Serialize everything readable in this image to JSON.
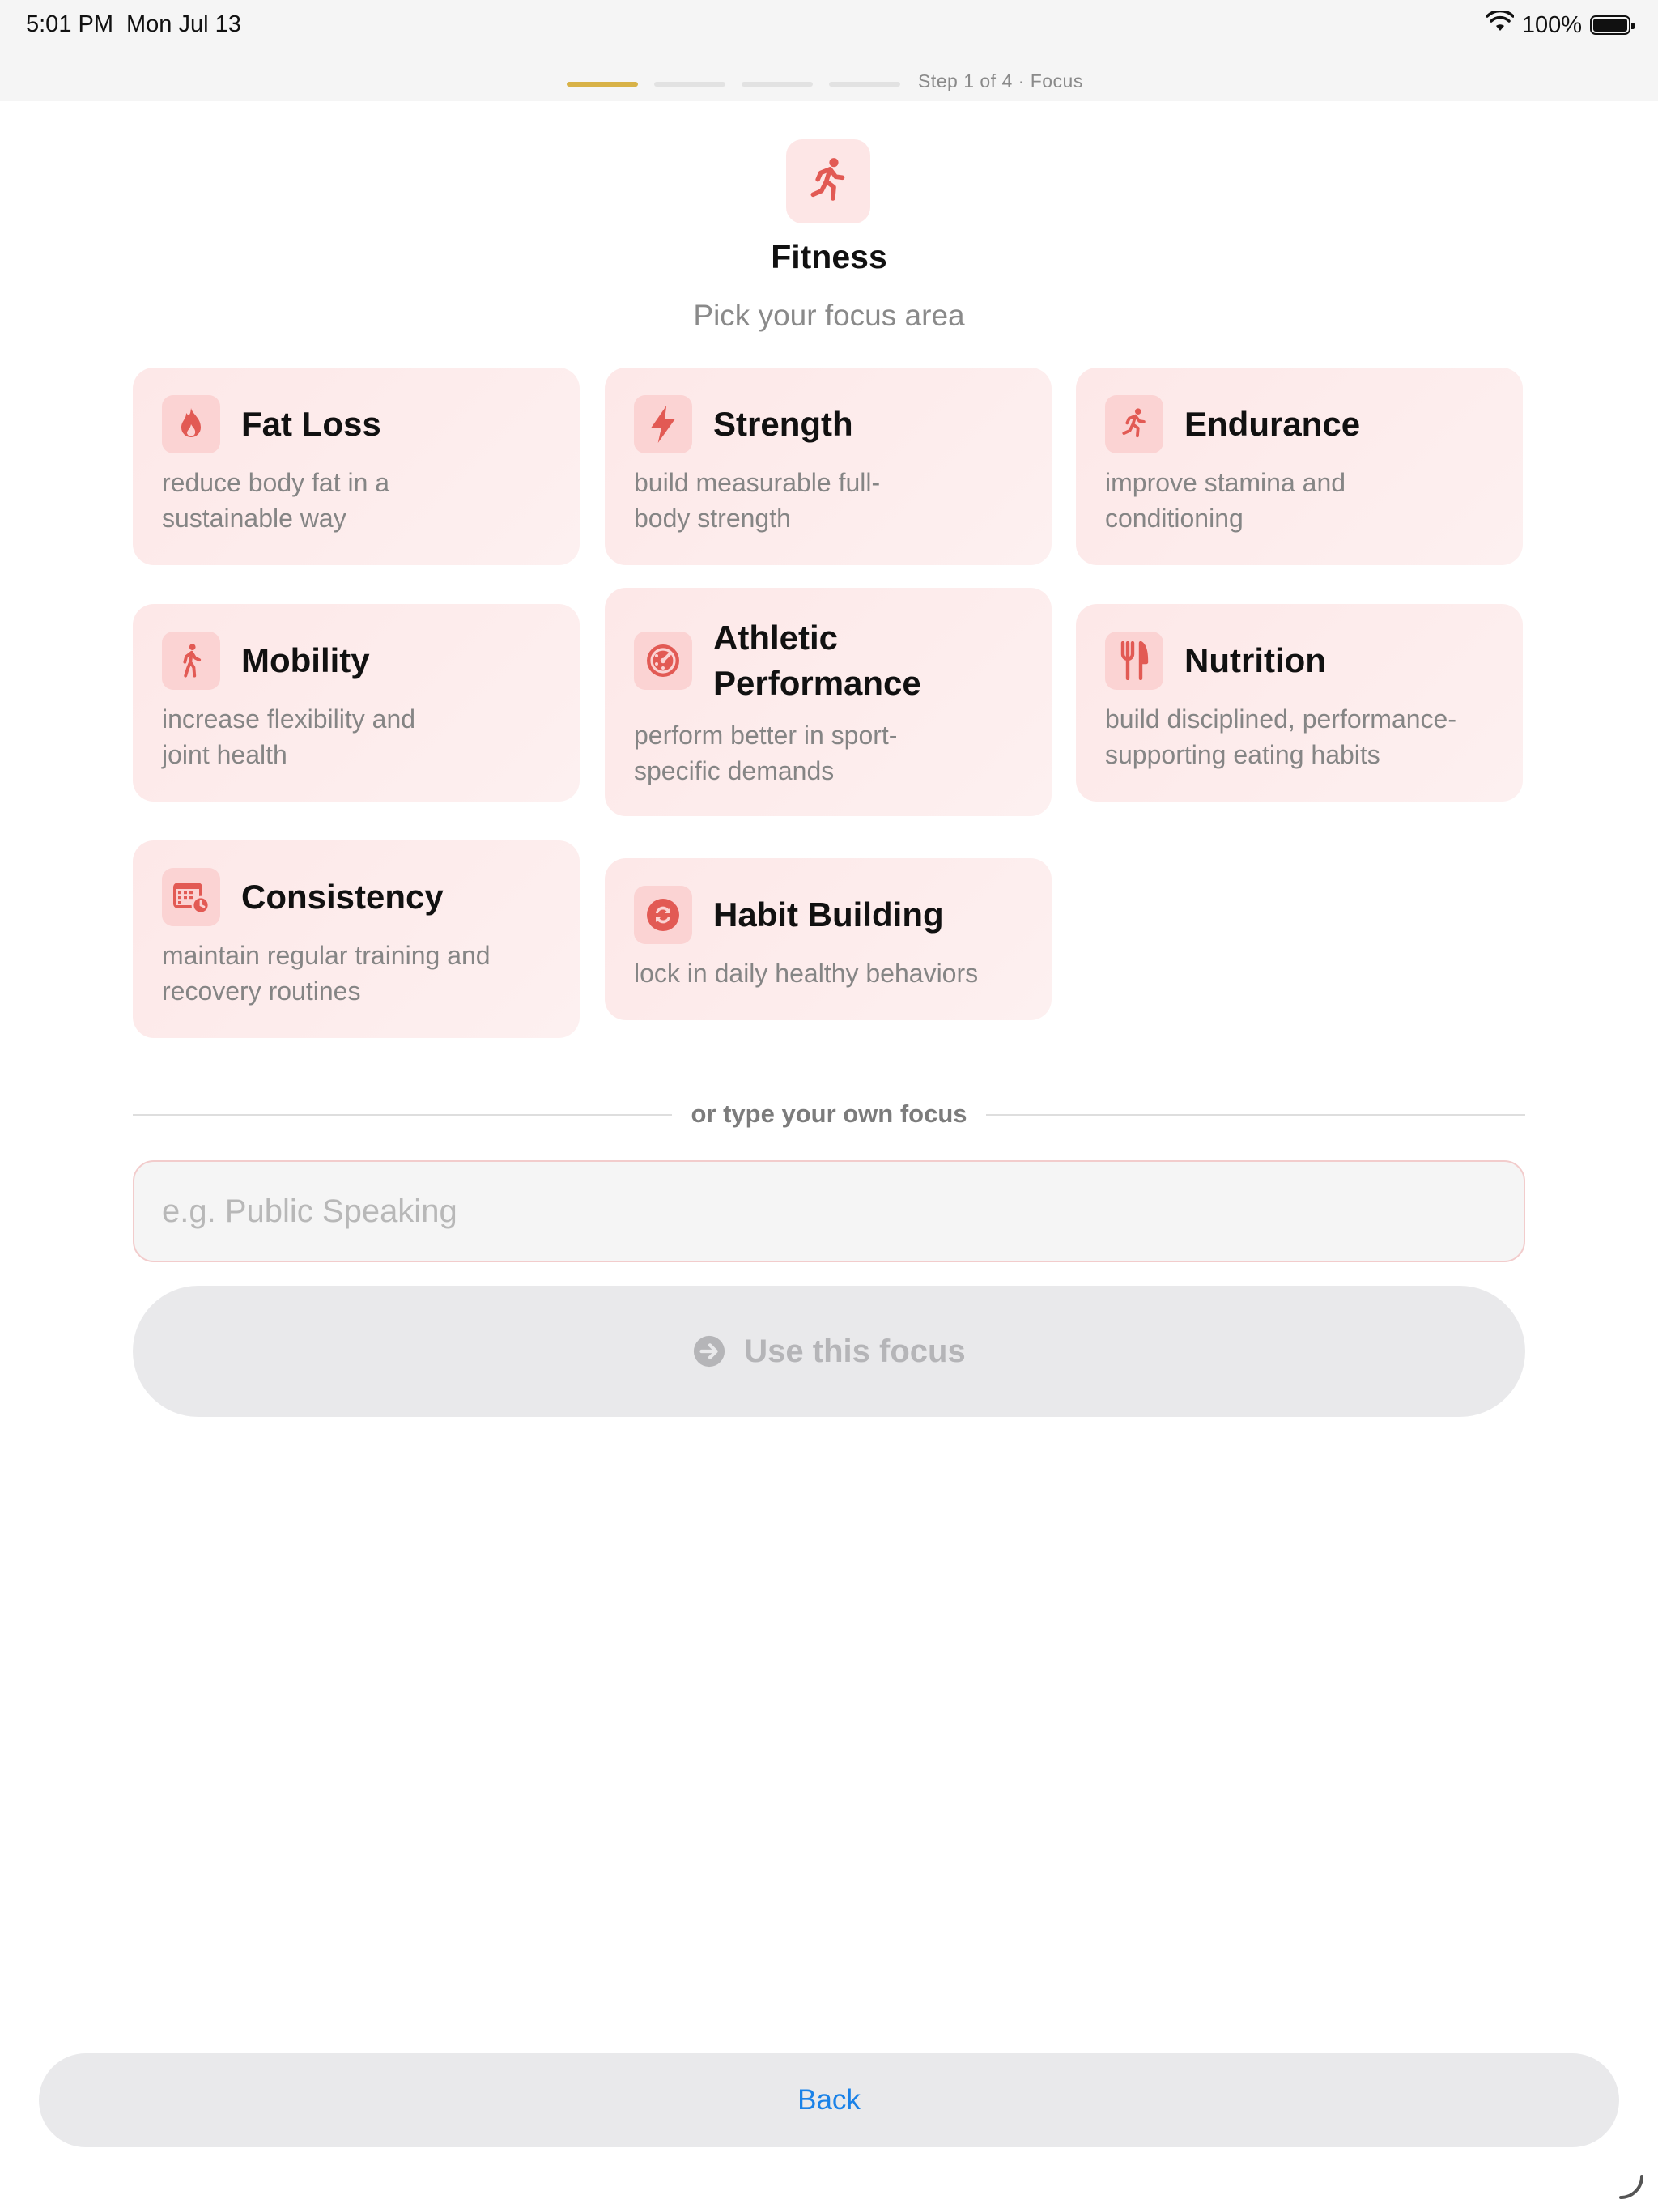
{
  "status_bar": {
    "time": "5:01 PM",
    "date": "Mon Jul 13",
    "battery": "100%",
    "battery_level": 1.0,
    "wifi_icon": "wifi-icon",
    "battery_icon": "battery-icon"
  },
  "progress": {
    "current_step": 1,
    "total_steps": 4,
    "label": "Step 1 of 4 · Focus",
    "active_color": "#d8b247"
  },
  "header": {
    "icon": "running-person-icon",
    "title": "Fitness",
    "subtitle": "Pick your focus area"
  },
  "accent_color": "#e25a54",
  "focus_areas": [
    {
      "title": "Fat Loss",
      "description": "reduce body fat in a sustainable way",
      "icon": "flame-icon"
    },
    {
      "title": "Strength",
      "description": "build measurable full-body strength",
      "icon": "bolt-icon"
    },
    {
      "title": "Endurance",
      "description": "improve stamina and conditioning",
      "icon": "running-person-icon"
    },
    {
      "title": "Mobility",
      "description": "increase flexibility and joint health",
      "icon": "walking-person-icon"
    },
    {
      "title": "Athletic Performance",
      "description": "perform better in sport-specific demands",
      "icon": "gauge-icon"
    },
    {
      "title": "Nutrition",
      "description": "build disciplined, performance-supporting eating habits",
      "icon": "fork-knife-icon"
    },
    {
      "title": "Consistency",
      "description": "maintain regular training and recovery routines",
      "icon": "calendar-clock-icon"
    },
    {
      "title": "Habit Building",
      "description": "lock in daily healthy behaviors",
      "icon": "repeat-icon"
    }
  ],
  "custom": {
    "divider_text": "or type your own focus",
    "placeholder": "e.g. Public Speaking",
    "value": "",
    "button_label": "Use this focus",
    "button_icon": "arrow-right-circle-icon"
  },
  "footer": {
    "back_label": "Back"
  }
}
